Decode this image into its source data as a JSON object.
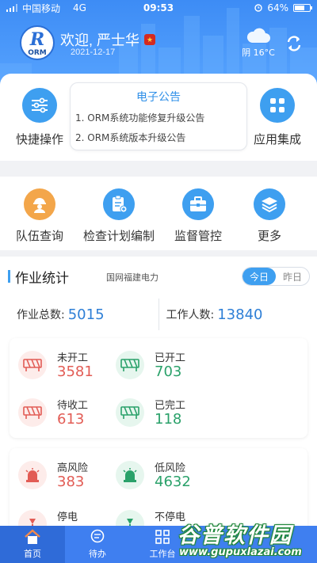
{
  "status_bar": {
    "carrier": "中国移动",
    "network": "4G",
    "time": "09:53",
    "battery": "64%",
    "battery_level": 0.64
  },
  "header": {
    "logo_text": "ORM",
    "logo_letter": "R",
    "welcome": "欢迎, 严士华",
    "date": "2021-12-17",
    "weather": "阴 16°C",
    "weather_icon": "cloud-icon",
    "refresh_icon": "refresh-icon"
  },
  "quick_actions": {
    "label": "快捷操作",
    "icon": "sliders-icon"
  },
  "notice": {
    "title": "电子公告",
    "items": [
      "1. ORM系统功能修复升级公告",
      "2. ORM系统版本升级公告"
    ]
  },
  "app_integration": {
    "label": "应用集成",
    "icon": "grid-icon"
  },
  "functions": [
    {
      "label": "队伍查询",
      "icon": "worker-icon",
      "color": "#f3a64a"
    },
    {
      "label": "检查计划编制",
      "icon": "clipboard-plus-icon",
      "color": "#3e9ff0"
    },
    {
      "label": "监督管控",
      "icon": "briefcase-icon",
      "color": "#3e9ff0"
    },
    {
      "label": "更多",
      "icon": "layers-icon",
      "color": "#3e9ff0"
    }
  ],
  "stats": {
    "title": "作业统计",
    "org": "国网福建电力",
    "toggle": [
      "今日",
      "昨日"
    ],
    "total_jobs_label": "作业总数:",
    "total_jobs": "5015",
    "workers_label": "工作人数:",
    "workers": "13840",
    "status_group": [
      {
        "name": "未开工",
        "value": "3581",
        "tone": "red",
        "icon": "barrier-icon"
      },
      {
        "name": "已开工",
        "value": "703",
        "tone": "green",
        "icon": "barrier-icon"
      },
      {
        "name": "待收工",
        "value": "613",
        "tone": "red",
        "icon": "barrier-icon"
      },
      {
        "name": "已完工",
        "value": "118",
        "tone": "green",
        "icon": "barrier-icon"
      }
    ],
    "risk_group": [
      {
        "name": "高风险",
        "value": "383",
        "tone": "red",
        "icon": "alarm-light-icon"
      },
      {
        "name": "低风险",
        "value": "4632",
        "tone": "green",
        "icon": "alarm-light-icon"
      },
      {
        "name": "停电",
        "value": "",
        "tone": "red",
        "icon": "power-off-icon"
      },
      {
        "name": "不停电",
        "value": "",
        "tone": "green",
        "icon": "power-on-icon"
      }
    ]
  },
  "tabbar": [
    {
      "label": "首页",
      "icon": "home-icon"
    },
    {
      "label": "待办",
      "icon": "chat-icon"
    },
    {
      "label": "工作台",
      "icon": "grid-icon"
    }
  ],
  "watermark": {
    "title": "谷普软件园",
    "url": "www.gupuxlazai.com"
  },
  "colors": {
    "primary": "#3e9ff0",
    "header_top": "#3d8cf5",
    "tabbar": "#3f7ff0",
    "red": "#e25c55",
    "green": "#2aa16a",
    "orange": "#f3a64a"
  }
}
